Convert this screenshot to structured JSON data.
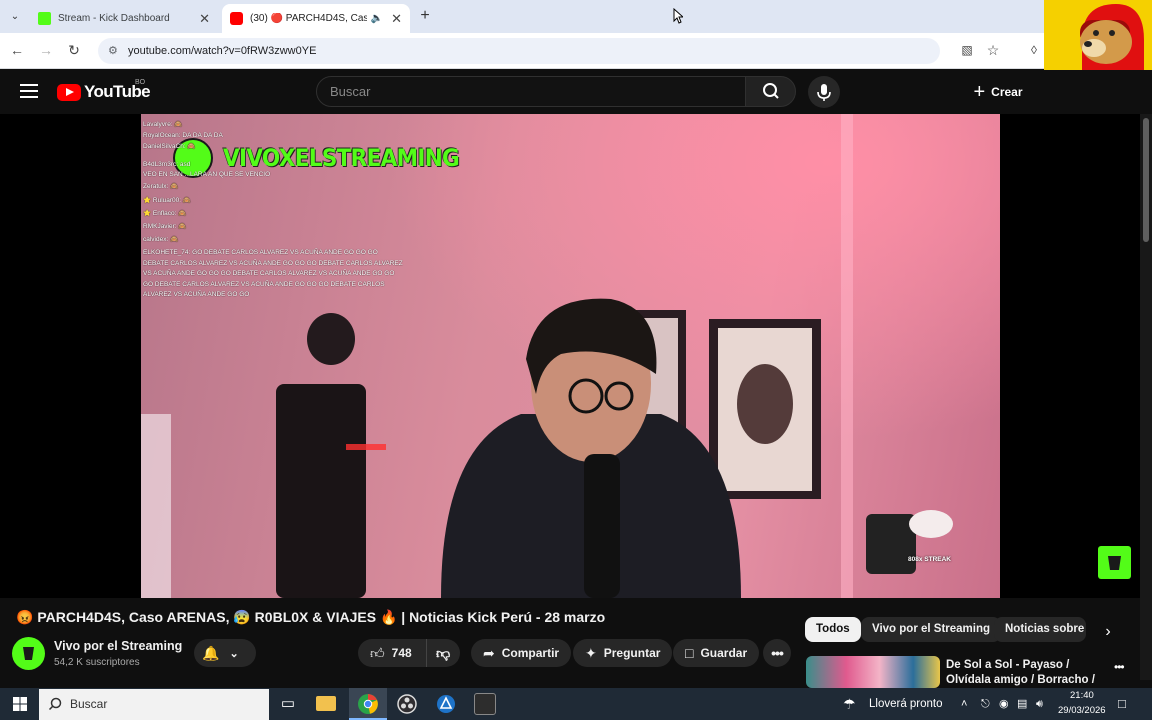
{
  "browser": {
    "tabs": [
      {
        "title": "Stream - Kick Dashboard",
        "active": false,
        "favicon_color": "#53fc18"
      },
      {
        "title": "(30) 🔴 PARCH4D4S, Caso",
        "active": true,
        "favicon_color": "#ff0000"
      }
    ],
    "url": "youtube.com/watch?v=0fRW3zww0YE"
  },
  "header": {
    "logo_text": "YouTube",
    "country_code": "BO",
    "search_placeholder": "Buscar",
    "create_label": "Crear"
  },
  "video": {
    "overlay_title": "VIVOXELSTREAMING",
    "chat": [
      "Lavalyvre: 🙈",
      "RoyalOcean: DA DA DA DA",
      "DanielSilvaCh: 🙈",
      "B4dL3m3rc: asd",
      "VEO EN SAN ...LARA AN QUE SE VENCIO",
      "Zeratulx: 🙈",
      "⭐ Ruluar00: 🙈",
      "⭐ Enflaco: 🙈",
      "RMKJavier: 🙈",
      "calvidex: 🙈",
      "ELKOHETE_74: GO DEBATE CARLOS ALVAREZ VS ACUÑA ANDE GO GO GO",
      "DEBATE CARLOS ALVAREZ VS ACUÑA ANDE GO GO GO DEBATE CARLOS ALVAREZ",
      "VS ACUÑA ANDE GO GO GO DEBATE CARLOS ALVAREZ VS ACUÑA ANDE GO GO",
      "GO DEBATE CARLOS ALVAREZ VS ACUÑA ANDE GO GO GO DEBATE CARLOS",
      "ALVAREZ VS ACUÑA ANDE GO GO"
    ],
    "streak_label": "808x STREAK",
    "title": "😡 PARCH4D4S, Caso ARENAS, 😰 R0BL0X & VIAJES 🔥 | Noticias Kick Perú - 28 marzo",
    "channel_name": "Vivo por el Streaming",
    "subscribers": "54,2 K suscriptores",
    "likes": "748",
    "share_label": "Compartir",
    "ask_label": "Preguntar",
    "save_label": "Guardar"
  },
  "chips": [
    "Todos",
    "Vivo por el Streaming",
    "Noticias sobre p"
  ],
  "recommendation": {
    "title": "De Sol a Sol - Payaso / Olvídala amigo / Borracho / Cruel ..."
  },
  "taskbar": {
    "search_placeholder": "Buscar",
    "weather": "Lloverá pronto",
    "time": "21:40",
    "date": "29/03/2026"
  },
  "colors": {
    "kick_green": "#53fc18",
    "youtube_red": "#ff0000",
    "yt_bg": "#0f0f0f"
  }
}
